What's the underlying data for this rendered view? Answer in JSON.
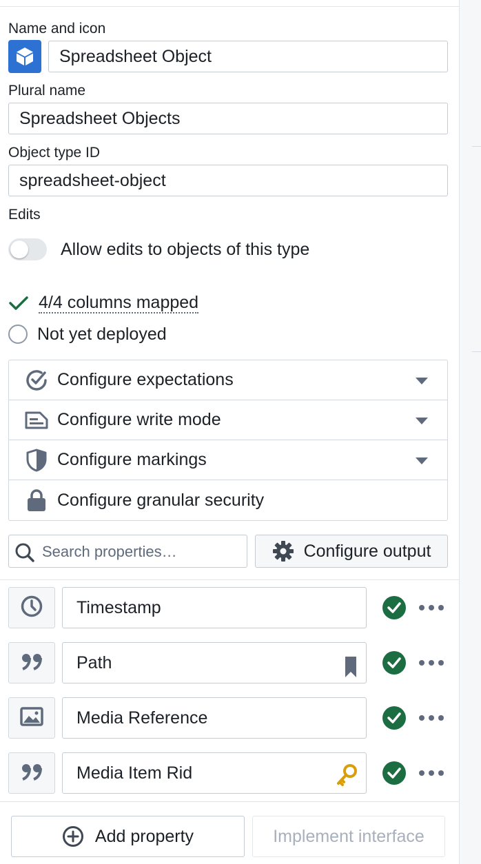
{
  "name_section": {
    "label": "Name and icon",
    "name_value": "Spreadsheet Object",
    "icon": "cube-icon"
  },
  "plural_section": {
    "label": "Plural name",
    "value": "Spreadsheet Objects"
  },
  "id_section": {
    "label": "Object type ID",
    "value": "spreadsheet-object"
  },
  "edits_section": {
    "label": "Edits",
    "toggle_label": "Allow edits to objects of this type",
    "toggle_on": false
  },
  "status": {
    "mapped": "4/4 columns mapped",
    "deployment": "Not yet deployed"
  },
  "config_items": [
    {
      "label": "Configure expectations",
      "icon": "check-circle-icon",
      "expandable": true
    },
    {
      "label": "Configure write mode",
      "icon": "write-mode-icon",
      "expandable": true
    },
    {
      "label": "Configure markings",
      "icon": "shield-icon",
      "expandable": true
    },
    {
      "label": "Configure granular security",
      "icon": "lock-icon",
      "expandable": false
    }
  ],
  "toolbar": {
    "search_placeholder": "Search properties…",
    "configure_output_label": "Configure output"
  },
  "properties": [
    {
      "name": "Timestamp",
      "type_icon": "clock-icon",
      "marker": null,
      "status": "valid"
    },
    {
      "name": "Path",
      "type_icon": "quote-icon",
      "marker": "bookmark-icon",
      "status": "valid"
    },
    {
      "name": "Media Reference",
      "type_icon": "image-icon",
      "marker": null,
      "status": "valid"
    },
    {
      "name": "Media Item Rid",
      "type_icon": "quote-icon",
      "marker": "key-icon",
      "status": "valid"
    }
  ],
  "footer": {
    "add_property_label": "Add property",
    "implement_interface_label": "Implement interface"
  },
  "colors": {
    "accent": "#2d72d2",
    "success": "#1c6e42",
    "key": "#d99e0b",
    "muted_text": "#5f6b7c"
  }
}
